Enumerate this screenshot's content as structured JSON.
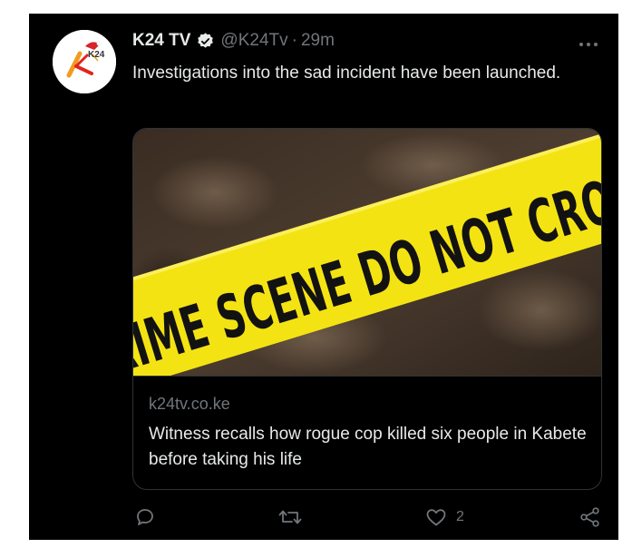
{
  "tweet": {
    "author_name": "K24 TV",
    "author_handle": "@K24Tv",
    "separator": "·",
    "timestamp": "29m",
    "text": "Investigations into the sad incident have been launched.",
    "avatar_logo_text": "K24"
  },
  "card": {
    "tape_text": "CRIME SCENE DO NOT CROSS",
    "domain": "k24tv.co.ke",
    "title": "Witness recalls how rogue cop killed six people in Kabete before taking his life"
  },
  "actions": {
    "reply_count": "",
    "retweet_count": "",
    "like_count": "2"
  },
  "icons": {
    "verified": "verified-badge-icon",
    "more": "more-options-icon",
    "reply": "reply-icon",
    "retweet": "retweet-icon",
    "like": "heart-icon",
    "share": "share-icon"
  },
  "colors": {
    "background": "#000000",
    "text_primary": "#e7e9ea",
    "text_secondary": "#71767b",
    "tape_yellow": "#f4e313"
  }
}
